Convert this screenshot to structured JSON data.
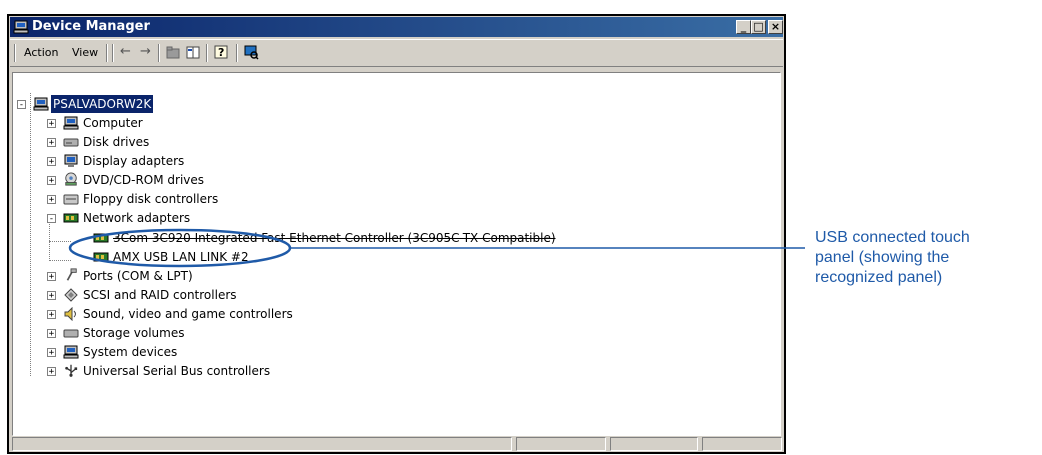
{
  "window": {
    "title": "Device Manager",
    "controls": {
      "minimize": "_",
      "maximize": "□",
      "close": "×"
    }
  },
  "toolbar": {
    "menus": [
      "Action",
      "View"
    ],
    "icons": [
      "back-arrow-icon",
      "forward-arrow-icon",
      "up-folder-icon",
      "properties-grid-icon",
      "help-icon",
      "scan-hardware-icon"
    ]
  },
  "tree": {
    "root": "PSALVADORW2K",
    "items": [
      {
        "label": "Computer",
        "icon": "computer-icon",
        "expanded": false
      },
      {
        "label": "Disk drives",
        "icon": "disk-drive-icon",
        "expanded": false
      },
      {
        "label": "Display adapters",
        "icon": "monitor-icon",
        "expanded": false
      },
      {
        "label": "DVD/CD-ROM drives",
        "icon": "cdrom-icon",
        "expanded": false
      },
      {
        "label": "Floppy disk controllers",
        "icon": "floppy-controller-icon",
        "expanded": false
      },
      {
        "label": "Network adapters",
        "icon": "network-card-icon",
        "expanded": true,
        "children": [
          {
            "label": "3Com 3C920 Integrated Fast Ethernet Controller (3C905C-TX Compatible)",
            "icon": "network-card-icon",
            "struck": true
          },
          {
            "label": "AMX USB LAN LINK #2",
            "icon": "network-card-icon"
          }
        ]
      },
      {
        "label": "Ports (COM & LPT)",
        "icon": "port-icon",
        "expanded": false
      },
      {
        "label": "SCSI and RAID controllers",
        "icon": "scsi-icon",
        "expanded": false
      },
      {
        "label": "Sound, video and game controllers",
        "icon": "speaker-icon",
        "expanded": false
      },
      {
        "label": "Storage volumes",
        "icon": "storage-volume-icon",
        "expanded": false
      },
      {
        "label": "System devices",
        "icon": "system-device-icon",
        "expanded": false
      },
      {
        "label": "Universal Serial Bus controllers",
        "icon": "usb-icon",
        "expanded": false
      }
    ]
  },
  "callout": {
    "lines": [
      "USB connected touch",
      "panel (showing the",
      "recognized panel)"
    ],
    "color": "#1f5aa8"
  },
  "colors": {
    "titlebar": "#0a246a",
    "selection": "#0a246a",
    "annotation": "#1f5aa8"
  }
}
